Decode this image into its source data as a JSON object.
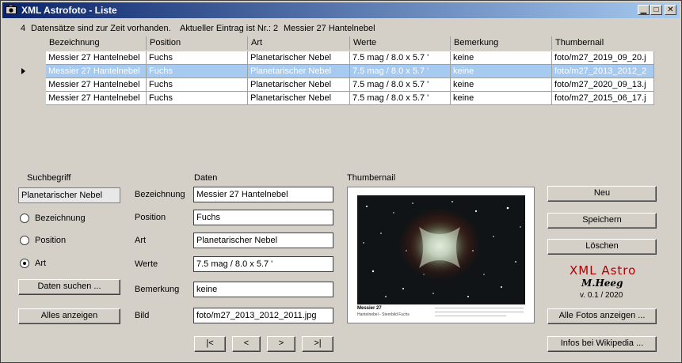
{
  "window": {
    "title": "XML Astrofoto - Liste"
  },
  "status": {
    "count": "4",
    "count_text": "Datensätze sind zur Zeit vorhanden.",
    "current_label": "Aktueller Eintrag ist Nr.: 2",
    "current_name": "Messier 27 Hantelnebel"
  },
  "table": {
    "columns": [
      "Bezeichnung",
      "Position",
      "Art",
      "Werte",
      "Bemerkung",
      "Thumbernail"
    ],
    "rows": [
      [
        "Messier 27 Hantelnebel",
        "Fuchs",
        "Planetarischer Nebel",
        "7.5 mag  /  8.0 x 5.7 '",
        "keine",
        "foto/m27_2019_09_20.j"
      ],
      [
        "Messier 27 Hantelnebel",
        "Fuchs",
        "Planetarischer Nebel",
        "7.5 mag  /  8.0 x 5.7 '",
        "keine",
        "foto/m27_2013_2012_2"
      ],
      [
        "Messier 27 Hantelnebel",
        "Fuchs",
        "Planetarischer Nebel",
        "7.5 mag  /  8.0 x 5.7 '",
        "keine",
        "foto/m27_2020_09_13.j"
      ],
      [
        "Messier 27 Hantelnebel",
        "Fuchs",
        "Planetarischer Nebel",
        "7.5 mag  /  8.0 x 5.7 '",
        "keine",
        "foto/m27_2015_06_17.j"
      ]
    ],
    "selected_row": 2
  },
  "search": {
    "heading": "Suchbegriff",
    "value": "Planetarischer Nebel",
    "options": [
      "Bezeichnung",
      "Position",
      "Art"
    ],
    "selected_option": "Art",
    "search_button": "Daten suchen ...",
    "show_all_button": "Alles anzeigen"
  },
  "details": {
    "heading": "Daten",
    "labels": {
      "bezeichnung": "Bezeichnung",
      "position": "Position",
      "art": "Art",
      "werte": "Werte",
      "bemerkung": "Bemerkung",
      "bild": "Bild"
    },
    "values": {
      "bezeichnung": "Messier 27 Hantelnebel",
      "position": "Fuchs",
      "art": "Planetarischer Nebel",
      "werte": "7.5 mag  /  8.0 x 5.7 '",
      "bemerkung": "keine",
      "bild": "foto/m27_2013_2012_2011.jpg"
    },
    "nav": {
      "first": "|<",
      "prev": "<",
      "next": ">",
      "last": ">|"
    }
  },
  "thumbnail": {
    "heading": "Thumbernail",
    "caption_title": "Messier 27",
    "caption_sub": "Hantelnebel - Sternbild Fuchs"
  },
  "actions": {
    "new": "Neu",
    "save": "Speichern",
    "delete": "Löschen",
    "all_photos": "Alle Fotos anzeigen ...",
    "wikipedia": "Infos bei Wikipedia ..."
  },
  "logo": {
    "name": "XML Astro",
    "author": "M.Heeg",
    "version": "v. 0.1 / 2020"
  }
}
